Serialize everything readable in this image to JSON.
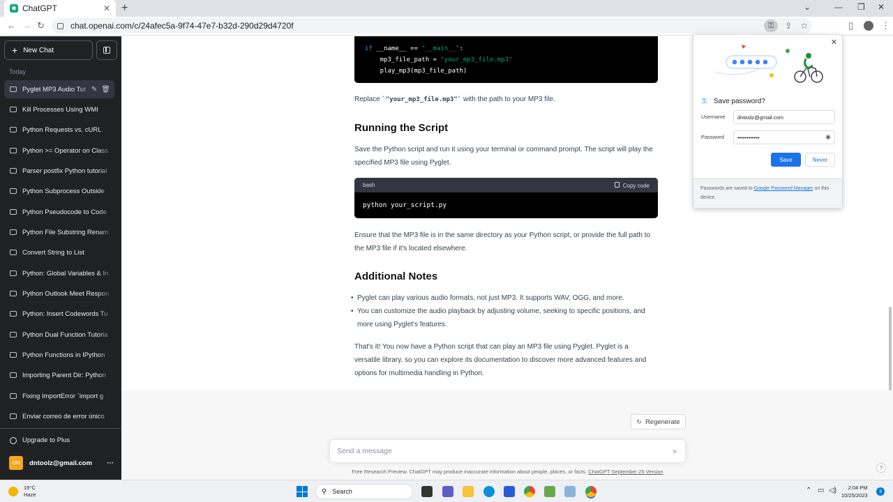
{
  "browser": {
    "tab_title": "ChatGPT",
    "tab_close": "✕",
    "new_tab": "+",
    "url": "chat.openai.com/c/24afec5a-9f74-47e7-b32d-290d29d4720f",
    "win_min": "⌄",
    "win_minimize": "—",
    "win_restore": "❐",
    "win_close": "✕"
  },
  "sidebar": {
    "new_chat": "New Chat",
    "section_today": "Today",
    "chats": [
      "Pyglet MP3 Audio Tut",
      "Kill Processes Using WMI",
      "Python Requests vs. cURL",
      "Python >= Operator on Class",
      "Parser postfix Python tutorial",
      "Python Subprocess Outside",
      "Python Pseudocode to Code",
      "Python File Substring Renam",
      "Convert String to List",
      "Python: Global Variables & In",
      "Python Outlook Meet Respon",
      "Python: Insert Codewords Tu",
      "Python Dual Function Tutoria",
      "Python Functions in IPython",
      "Importing Parent Dir: Python",
      "Fixing ImportError `import g",
      "Enviar correo de error único"
    ],
    "upgrade": "Upgrade to Plus",
    "user_initials": "DN",
    "user_email": "dntoolz@gmail.com",
    "more": "···"
  },
  "content": {
    "code_top": {
      "line1_kw": "if",
      "line1_rest": " __name__ == ",
      "line1_str": "\"__main__\"",
      "line1_end": ":",
      "line2_var": "    mp3_file_path = ",
      "line2_str": "\"your_mp3_file.mp3\"",
      "line3": "    play_mp3(mp3_file_path)"
    },
    "replace_pre": "Replace ",
    "replace_code": "`\"your_mp3_file.mp3\"`",
    "replace_post": " with the path to your MP3 file.",
    "h_running": "Running the Script",
    "p_running": "Save the Python script and run it using your terminal or command prompt. The script will play the specified MP3 file using Pyglet.",
    "bash_lang": "bash",
    "copy_code": "Copy code",
    "bash_code": "python your_script.py",
    "p_ensure": "Ensure that the MP3 file is in the same directory as your Python script, or provide the full path to the MP3 file if it's located elsewhere.",
    "h_notes": "Additional Notes",
    "bullets": [
      "Pyglet can play various audio formats, not just MP3. It supports WAV, OGG, and more.",
      "You can customize the audio playback by adjusting volume, seeking to specific positions, and more using Pyglet's features."
    ],
    "p_final": "That's it! You now have a Python script that can play an MP3 file using Pyglet. Pyglet is a versatile library, so you can explore its documentation to discover more advanced features and options for multimedia handling in Python.",
    "regenerate": "Regenerate",
    "message_placeholder": "Send a message",
    "disclaimer_pre": "Free Research Preview. ChatGPT may produce inaccurate information about people, places, or facts. ",
    "disclaimer_link": "ChatGPT September 25 Version",
    "help": "?"
  },
  "password_popup": {
    "title": "Save password?",
    "username_label": "Username",
    "username_value": "dntoolz@gmail.com",
    "password_label": "Password",
    "password_value": "••••••••••••",
    "save": "Save",
    "never": "Never",
    "footer_pre": "Passwords are saved to ",
    "footer_link": "Google Password Manager",
    "footer_post": " on this device."
  },
  "taskbar": {
    "temperature": "19°C",
    "weather": "Haze",
    "search": "Search",
    "time": "2:04 PM",
    "date": "10/25/2023",
    "notifications": "3"
  },
  "colors": {
    "sidebar_bg": "#202123",
    "accent_green": "#10a37f",
    "chrome_blue": "#1a73e8"
  }
}
